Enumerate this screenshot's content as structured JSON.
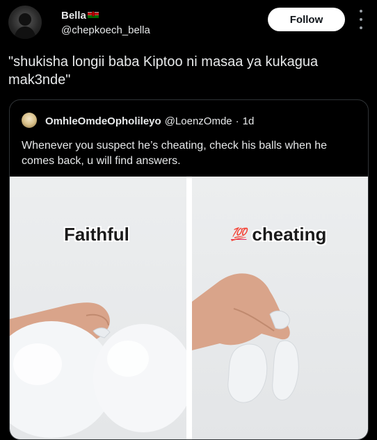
{
  "author": {
    "display_name": "Bella",
    "flag_icon": "kenya-flag-icon",
    "handle": "@chepkoech_bella"
  },
  "follow_label": "Follow",
  "tweet_text": "\"shukisha longii baba Kiptoo ni masaa ya kukagua mak3nde\"",
  "quoted": {
    "display_name": "OmhleOmdeOpholileyo",
    "handle": "@LoenzOmde",
    "separator": "·",
    "time": "1d",
    "text": "Whenever you suspect he’s cheating, check his balls when he comes back, u will find answers.",
    "media": {
      "left_caption": "Faithful",
      "right_emoji": "💯",
      "right_caption": "cheating"
    }
  }
}
